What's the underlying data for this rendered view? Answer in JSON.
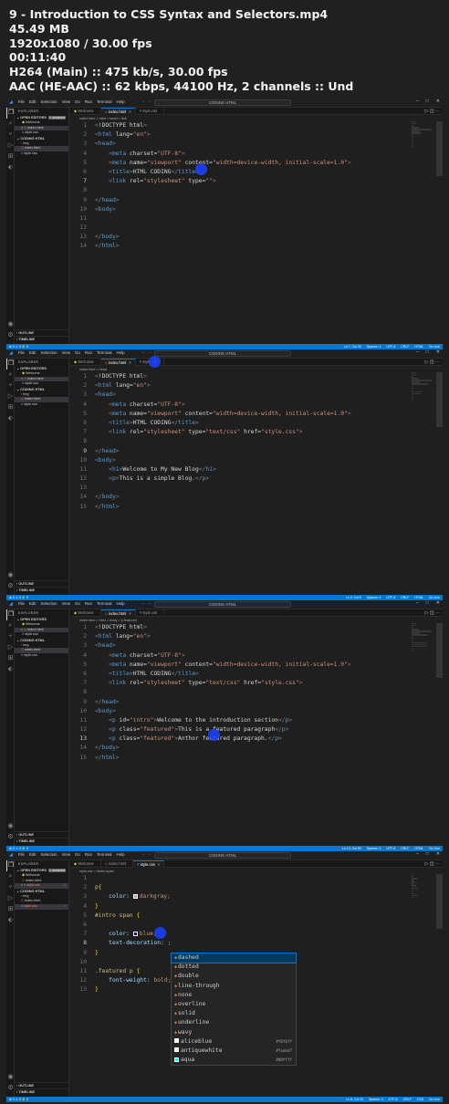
{
  "video_info": {
    "title": "9 - Introduction to CSS Syntax and Selectors.mp4",
    "size": "45.49 MB",
    "resolution": "1920x1080 / 30.00 fps",
    "duration": "00:11:40",
    "video_codec": "H264 (Main) :: 475 kb/s, 30.00 fps",
    "audio_codec": "AAC (HE-AAC) :: 62 kbps, 44100 Hz, 2 channels :: Und"
  },
  "app": {
    "menu": [
      "File",
      "Edit",
      "Selection",
      "View",
      "Go",
      "Run",
      "Terminal",
      "Help"
    ],
    "command_center": "CODING HTML",
    "explorer_label": "EXPLORER",
    "open_editors_label": "OPEN EDITORS",
    "open_editors_badge": "1 unsaved",
    "folder_label": "CODING HTML",
    "outline_label": "OUTLINE",
    "timeline_label": "TIMELINE",
    "tab_welcome": "Welcome",
    "tab_index": "index.html",
    "tab_style": "style.css"
  },
  "frames": [
    {
      "open_editors": [
        "Welcome",
        "index.html",
        "style.css"
      ],
      "folder_items": [
        "img",
        "index.html",
        "style.css"
      ],
      "breadcrumb": "index.html > html > head > link",
      "status_left": "⊗ 0 ⚠ 0   ⚡ 0",
      "status_right": [
        "Ln 7, Col 33",
        "Spaces: 4",
        "UTF-8",
        "CRLF",
        "HTML",
        "Go Live"
      ],
      "lines": [
        "<!DOCTYPE html>",
        "<html lang=\"en\">",
        "<head>",
        "    <meta charset=\"UTF-8\">",
        "    <meta name=\"viewport\" content=\"width=device-width, initial-scale=1.0\">",
        "    <title>HTML CODING</title>",
        "    <link rel=\"stylesheet\" type=\"\">",
        "",
        "</head>",
        "<body>",
        "",
        "",
        "</body>",
        "</html>"
      ],
      "current_line": 7
    },
    {
      "open_editors": [
        "Welcome",
        "index.html",
        "style.css"
      ],
      "folder_items": [
        "img",
        "index.html",
        "style.css"
      ],
      "breadcrumb": "index.html > head",
      "status_left": "⊗ 0 ⚠ 0   ⚡ 0",
      "status_right": [
        "Ln 9, Col 8",
        "Spaces: 4",
        "UTF-8",
        "CRLF",
        "HTML",
        "Go Live"
      ],
      "lines": [
        "<!DOCTYPE html>",
        "<html lang=\"en\">",
        "<head>",
        "    <meta charset=\"UTF-8\">",
        "    <meta name=\"viewport\" content=\"width=device-width, initial-scale=1.0\">",
        "    <title>HTML CODING</title>",
        "    <link rel=\"stylesheet\" type=\"text/css\" href=\"style.css\">",
        "",
        "</head>",
        "<body>",
        "    <h1>Welcome to My New Blog</h1>",
        "    <p>This is a simple Blog.</p>",
        "",
        "</body>",
        "</html>"
      ],
      "current_line": 9
    },
    {
      "open_editors": [
        "Welcome",
        "index.html",
        "style.css"
      ],
      "folder_items": [
        "img",
        "index.html",
        "style.css"
      ],
      "breadcrumb": "index.html > html > body > p.featured",
      "status_left": "⊗ 0 ⚠ 0   ⚡ 0",
      "status_right": [
        "Ln 13, Col 50",
        "Spaces: 4",
        "UTF-8",
        "CRLF",
        "HTML",
        "Go Live"
      ],
      "lines": [
        "<!DOCTYPE html>",
        "<html lang=\"en\">",
        "<head>",
        "    <meta charset=\"UTF-8\">",
        "    <meta name=\"viewport\" content=\"width=device-width, initial-scale=1.0\">",
        "    <title>HTML CODING</title>",
        "    <link rel=\"stylesheet\" type=\"text/css\" href=\"style.css\">",
        "",
        "</head>",
        "<body>",
        "    <p id=\"intro\">Welcome to the introduction section</p>",
        "    <p class=\"featured\">This is a featured paragraph</p>",
        "    <p class=\"featured\">Anthor featured paragraph.</p>",
        "</body>",
        "</html>"
      ],
      "current_line": 13
    },
    {
      "open_editors": [
        "Welcome",
        "index.html",
        "style.css"
      ],
      "folder_items": [
        "img",
        "index.html",
        "style.css"
      ],
      "breadcrumb": "style.css > #intro span",
      "status_left": "⊗ 0 ⚠ 0   ⚡ 0",
      "status_right": [
        "Ln 8, Col 22",
        "Spaces: 4",
        "UTF-8",
        "CRLF",
        "CSS",
        "Go Live"
      ],
      "lines": [
        "",
        "p{",
        "    color: darkgray;",
        "}",
        "#intro span {",
        "",
        "    color: blue;",
        "    text-decoration: ;",
        "}",
        "",
        ".featured p {",
        "    font-weight: bold;",
        "}"
      ],
      "current_line": 8,
      "suggestions": [
        {
          "label": "dashed",
          "hex": ""
        },
        {
          "label": "dotted",
          "hex": ""
        },
        {
          "label": "double",
          "hex": ""
        },
        {
          "label": "line-through",
          "hex": ""
        },
        {
          "label": "none",
          "hex": ""
        },
        {
          "label": "overline",
          "hex": ""
        },
        {
          "label": "solid",
          "hex": ""
        },
        {
          "label": "underline",
          "hex": ""
        },
        {
          "label": "wavy",
          "hex": ""
        },
        {
          "label": "aliceblue",
          "hex": "#f0f8ff"
        },
        {
          "label": "antiquewhite",
          "hex": "#faebd7"
        },
        {
          "label": "aqua",
          "hex": "#00ffff"
        }
      ]
    }
  ],
  "colors": {
    "accent": "#0078d4",
    "statusbar": "#0078d4",
    "editor_bg": "#1f1f1f",
    "sidebar_bg": "#181818",
    "swatch_darkgray": "#a9a9a9",
    "swatch_blue": "#0000ff",
    "swatch_aliceblue": "#f0f8ff",
    "swatch_antiquewhite": "#faebd7",
    "swatch_aqua": "#00ffff"
  }
}
